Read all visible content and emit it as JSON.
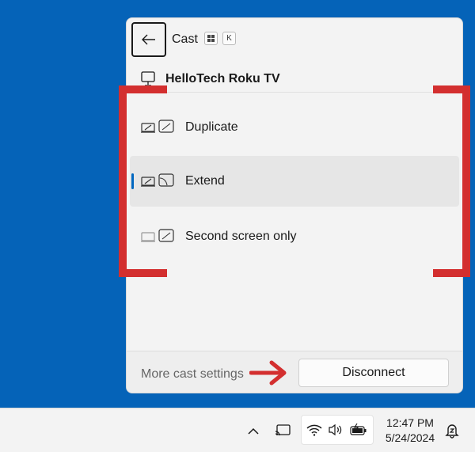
{
  "panel": {
    "title": "Cast",
    "shortcut": {
      "win_key_icon": "windows-logo-icon",
      "key": "K"
    },
    "device_name": "HelloTech Roku TV",
    "modes": [
      {
        "label": "Duplicate",
        "icon": "duplicate-display-icon",
        "selected": false
      },
      {
        "label": "Extend",
        "icon": "extend-display-icon",
        "selected": true
      },
      {
        "label": "Second screen only",
        "icon": "second-screen-only-icon",
        "selected": false
      }
    ],
    "footer": {
      "more_settings": "More cast settings",
      "disconnect": "Disconnect"
    }
  },
  "taskbar": {
    "time": "12:47 PM",
    "date": "5/24/2024",
    "icons": [
      "chevron-up-icon",
      "cast-icon",
      "wifi-icon",
      "volume-icon",
      "battery-icon",
      "notification-bell-icon"
    ]
  },
  "colors": {
    "desktop": "#0563b8",
    "accent": "#0067c0",
    "annotation": "#d32f2f"
  }
}
